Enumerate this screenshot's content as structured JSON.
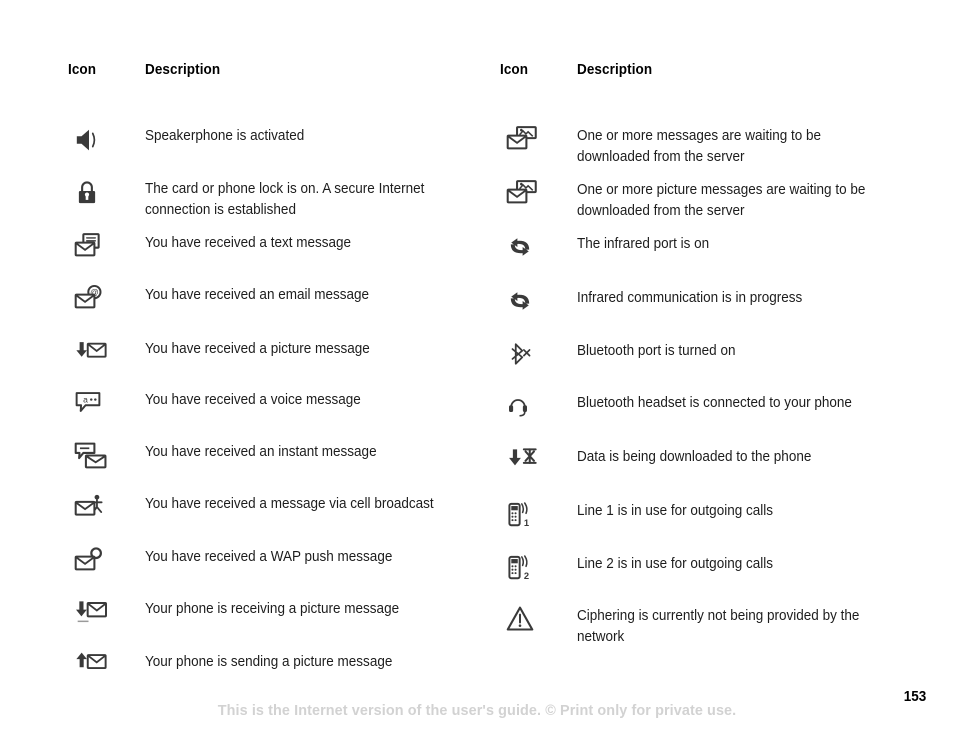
{
  "document": {
    "page_number": "153",
    "footer_note": "This is the Internet version of the user's guide. © Print only for private use."
  },
  "columns": [
    {
      "headers": {
        "icon": "Icon",
        "description": "Description"
      },
      "rows": [
        {
          "icon": "speakerphone-icon",
          "description": "Speakerphone is activated"
        },
        {
          "icon": "padlock-icon",
          "description": "The card or phone lock is on. A secure Internet connection is established"
        },
        {
          "icon": "text-message-icon",
          "description": "You have received a text message"
        },
        {
          "icon": "email-message-icon",
          "description": "You have received an email message"
        },
        {
          "icon": "picture-message-received-icon",
          "description": "You have received a picture message"
        },
        {
          "icon": "voice-message-icon",
          "description": "You have received a voice message"
        },
        {
          "icon": "instant-message-icon",
          "description": "You have received an instant message"
        },
        {
          "icon": "cell-broadcast-message-icon",
          "description": "You have received a message via cell broadcast"
        },
        {
          "icon": "wap-push-message-icon",
          "description": "You have received a WAP push message"
        },
        {
          "icon": "picture-message-receiving-icon",
          "description": "Your phone is receiving a picture message"
        },
        {
          "icon": "picture-message-sending-icon",
          "description": "Your phone is sending a picture message"
        }
      ]
    },
    {
      "headers": {
        "icon": "Icon",
        "description": "Description"
      },
      "rows": [
        {
          "icon": "messages-waiting-icon",
          "description": "One or more messages are waiting to be downloaded from the server"
        },
        {
          "icon": "picture-messages-waiting-icon",
          "description": "One or more picture messages are waiting to be downloaded from the server"
        },
        {
          "icon": "infrared-on-icon",
          "description": "The infrared port is on"
        },
        {
          "icon": "infrared-active-icon",
          "description": "Infrared communication is in progress"
        },
        {
          "icon": "bluetooth-on-icon",
          "description": "Bluetooth port is turned on"
        },
        {
          "icon": "bluetooth-headset-icon",
          "description": "Bluetooth headset is connected to your phone"
        },
        {
          "icon": "data-download-icon",
          "description": "Data is being downloaded to the phone"
        },
        {
          "icon": "line-1-in-use-icon",
          "description": "Line 1 is in use for outgoing calls"
        },
        {
          "icon": "line-2-in-use-icon",
          "description": "Line 2 is in use for outgoing calls"
        },
        {
          "icon": "ciphering-warning-icon",
          "description": "Ciphering is currently not being provided by the network"
        }
      ]
    }
  ],
  "colors": {
    "text": "#1d1d1d",
    "heading": "#000000",
    "icon": "#3a3a3a",
    "footer": "#d2d2d2",
    "background": "#ffffff"
  }
}
